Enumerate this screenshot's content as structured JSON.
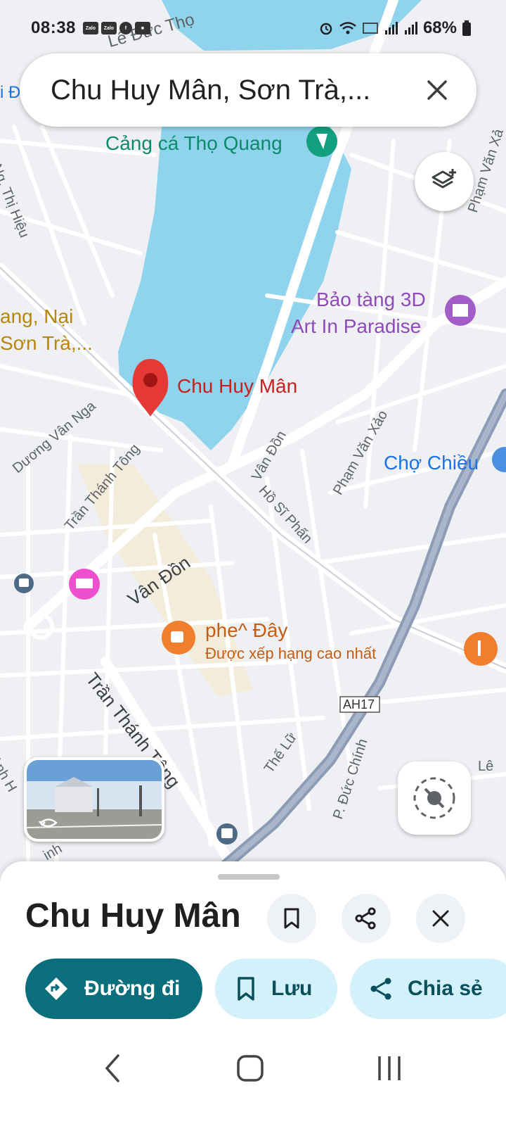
{
  "status_bar": {
    "time": "08:38",
    "app_icons": [
      "Zalo",
      "Zalo",
      "f",
      "■"
    ],
    "battery": "68%"
  },
  "search": {
    "query": "Chu Huy Mân, Sơn Trà,..."
  },
  "map": {
    "poi": {
      "port": "Cảng cá Thọ Quang",
      "museum_line1": "Bảo tàng 3D",
      "museum_line2": "Art In Paradise",
      "pin": "Chu Huy Mân",
      "area_line1": "ang, Nại",
      "area_line2": "Sơn Trà,...",
      "market": "Chợ Chiều",
      "cafe_name": "phe^ Đây",
      "cafe_note": "Được xếp hạng cao nhất",
      "highway": "AH17"
    },
    "streets": {
      "le_duc_tho": "Lê Đức Thọ",
      "thi_hieu": "Ng. Thị Hiệu",
      "duong_van_nga": "Dương Vân Nga",
      "tran_thanh_tong_small": "Trần Thánh Tông",
      "van_don_big": "Vân Đồn",
      "van_don_small": "Vân Đồn",
      "ho_si_phan": "Hồ Sĩ Phấn",
      "pham_van_xao": "Phạm Văn Xảo",
      "tran_thanh_tong_big": "Trần Thánh Tông",
      "the_lu": "Thế Lữ",
      "duc_chinh": "P. Đức Chính",
      "pham_van_right": "Phạm Văn Xả",
      "le_right": "Lê",
      "edge_left_top": "i Đ",
      "edge_left_bottom": "Anh H",
      "edge_bottom": "inh"
    }
  },
  "sheet": {
    "title": "Chu Huy Mân",
    "directions_label": "Đường đi",
    "save_label": "Lưu",
    "share_label": "Chia sẻ"
  }
}
